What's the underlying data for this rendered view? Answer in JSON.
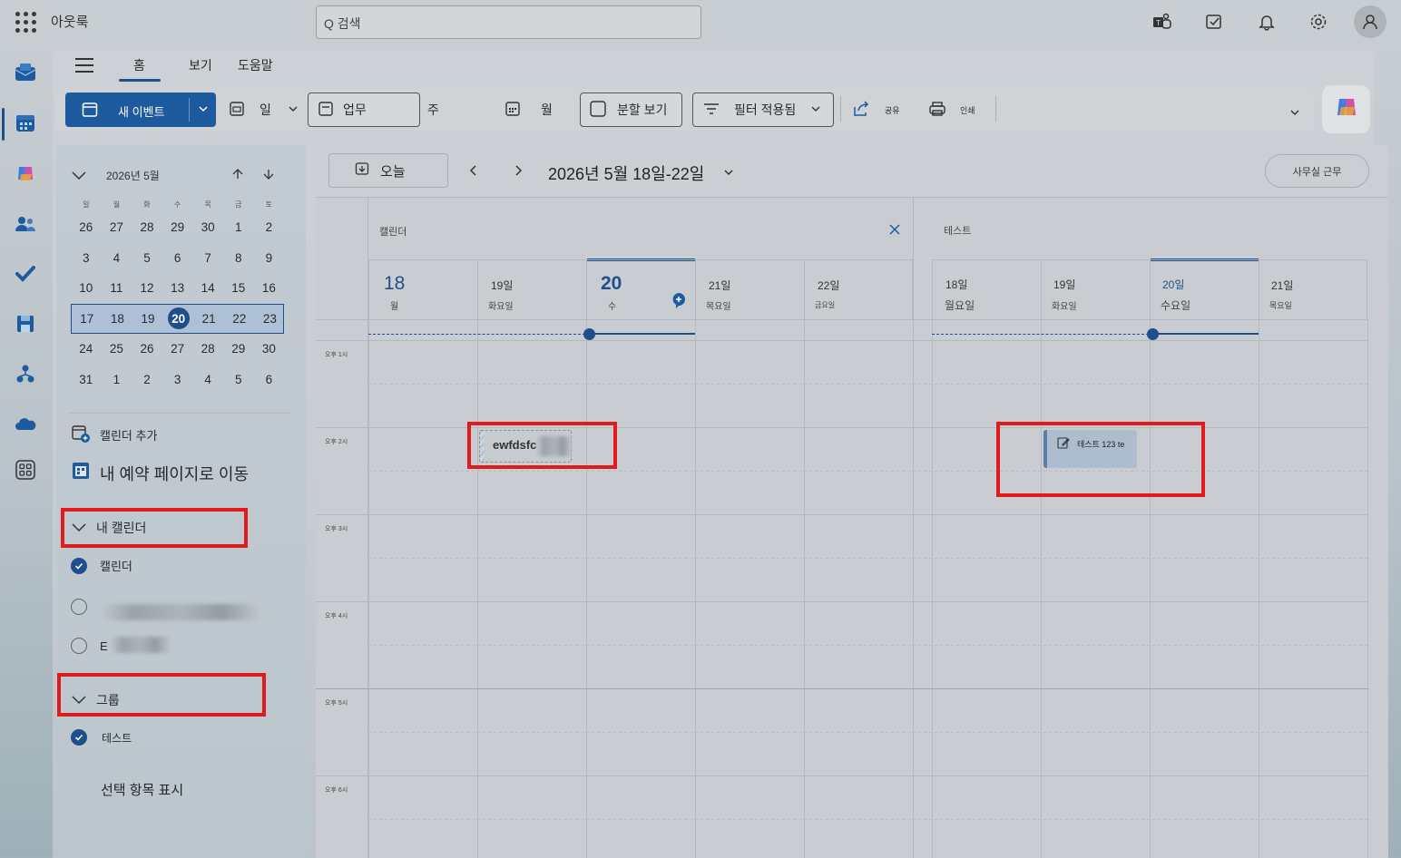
{
  "app": {
    "title": "아웃룩"
  },
  "search": {
    "placeholder": "Q 검색"
  },
  "ribbon_tabs": [
    "홈",
    "보기",
    "도움말"
  ],
  "toolbar": {
    "new_event": "새 이벤트",
    "day": "일",
    "work_week": "업무",
    "week": "주",
    "month": "월",
    "split_view": "분할 보기",
    "filter": "필터 적용됨",
    "share": "공유",
    "print": "인쇄"
  },
  "mini_calendar": {
    "title": "2026년 5월",
    "dow": [
      "일",
      "월",
      "화",
      "수",
      "목",
      "금",
      "토"
    ],
    "weeks": [
      [
        "26",
        "27",
        "28",
        "29",
        "30",
        "1",
        "2"
      ],
      [
        "3",
        "4",
        "5",
        "6",
        "7",
        "8",
        "9"
      ],
      [
        "10",
        "11",
        "12",
        "13",
        "14",
        "15",
        "16"
      ],
      [
        "17",
        "18",
        "19",
        "20",
        "21",
        "22",
        "23"
      ],
      [
        "24",
        "25",
        "26",
        "27",
        "28",
        "29",
        "30"
      ],
      [
        "31",
        "1",
        "2",
        "3",
        "4",
        "5",
        "6"
      ]
    ],
    "today": "20"
  },
  "left_pane": {
    "add_calendar": "캘린더 추가",
    "booking_page": "내 예약 페이지로 이동",
    "my_calendars_header": "내 캘린더",
    "my_calendars": [
      {
        "label": "캘린더",
        "checked": true
      },
      {
        "label": "",
        "checked": false
      },
      {
        "label": "E",
        "checked": false
      }
    ],
    "groups_header": "그룹",
    "groups": [
      {
        "label": "테스트",
        "checked": true
      }
    ],
    "show_selected": "선택 항목 표시"
  },
  "calendar_header": {
    "today_button": "오늘",
    "date_range": "2026년 5월 18일-22일",
    "office_button": "사무실 근무"
  },
  "time_labels": [
    "오후 1시",
    "오후 2시",
    "오후 3시",
    "오후 4시",
    "오후 5시",
    "오후 6시"
  ],
  "panes": [
    {
      "title": "캘린더",
      "days": [
        {
          "num": "18",
          "sub": "월",
          "style": "big"
        },
        {
          "num": "19일",
          "sub": "화요일",
          "style": "normal"
        },
        {
          "num": "20",
          "sub": "수",
          "style": "today"
        },
        {
          "num": "21일",
          "sub": "목요일",
          "style": "normal"
        },
        {
          "num": "22일",
          "sub": "금요일",
          "style": "normal"
        }
      ],
      "event": {
        "title": "ewfdsfc"
      }
    },
    {
      "title": "테스트",
      "days": [
        {
          "num": "18일",
          "sub": "월요일"
        },
        {
          "num": "19일",
          "sub": "화요일"
        },
        {
          "num": "20일",
          "sub": "수요일"
        },
        {
          "num": "21일",
          "sub": "목요일"
        }
      ],
      "event": {
        "title": "테스트 123 te"
      }
    }
  ],
  "colors": {
    "accent": "#1e4f8c",
    "highlight": "#e01b1b"
  }
}
